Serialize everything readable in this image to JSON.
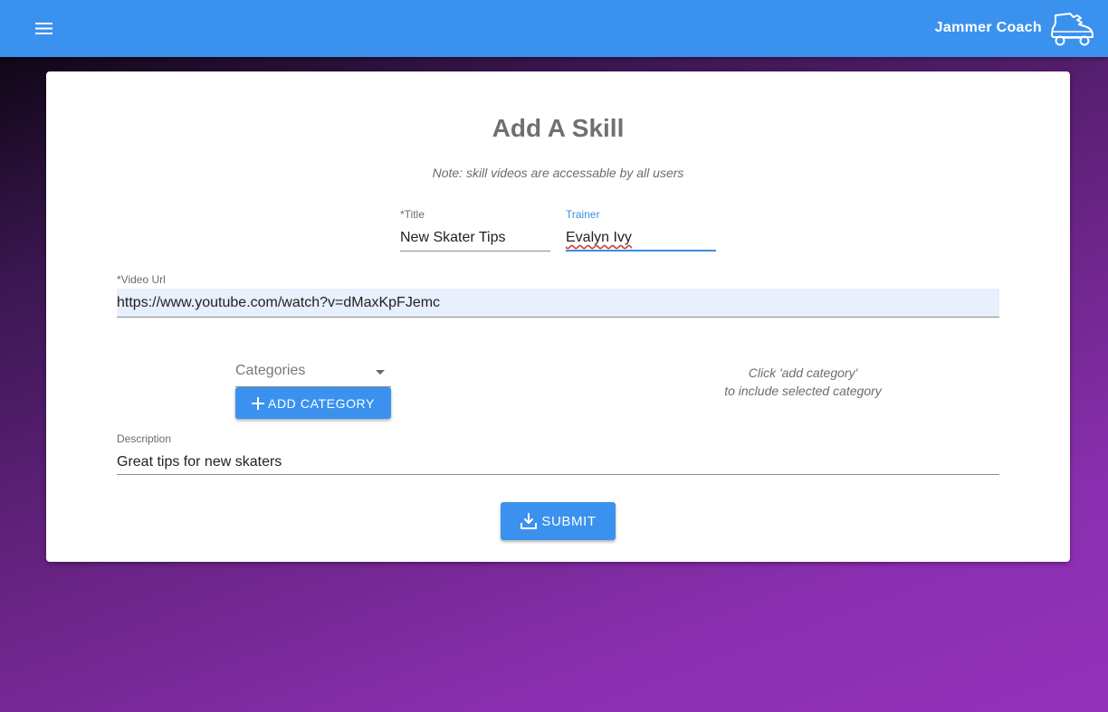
{
  "appbar": {
    "title": "Jammer Coach",
    "menu_icon": "hamburger-icon",
    "logo_icon": "roller-skate-icon"
  },
  "form": {
    "heading": "Add A Skill",
    "note": "Note: skill videos are accessable by all users",
    "title_field": {
      "label": "*Title",
      "value": "New Skater Tips"
    },
    "trainer_field": {
      "label": "Trainer",
      "value": "Evalyn Ivy"
    },
    "video_url_field": {
      "label": "*Video Url",
      "value": "https://www.youtube.com/watch?v=dMaxKpFJemc"
    },
    "categories_select": {
      "placeholder": "Categories"
    },
    "add_category_label": "ADD CATEGORY",
    "hint_line1": "Click 'add category'",
    "hint_line2": "to include selected category",
    "description_field": {
      "label": "Description",
      "value": "Great tips for new skaters"
    },
    "submit_label": "SUBMIT"
  },
  "colors": {
    "primary": "#3a92ee",
    "focus": "#3a8fe0",
    "background_start": "#050307",
    "background_end": "#9432bb"
  }
}
